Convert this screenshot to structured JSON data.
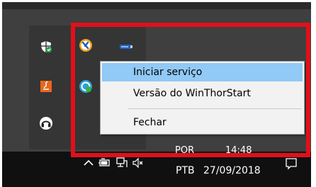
{
  "context_menu": {
    "items": [
      {
        "label": "Iniciar serviço",
        "highlighted": true
      },
      {
        "label": "Versão do WinThorStart",
        "highlighted": false
      },
      {
        "label": "Fechar",
        "highlighted": false
      }
    ]
  },
  "tray_overflow": {
    "icons": [
      "windows-defender-shield-icon",
      "winthor-app-icon",
      "usb-drive-icon",
      "java-icon",
      "refresh-sync-icon",
      "headset-app-icon"
    ]
  },
  "taskbar": {
    "language_line1": "POR",
    "language_line2": "PTB",
    "time": "14:48",
    "date": "27/09/2018",
    "icons": [
      "chevron-up-icon",
      "battery-icon",
      "network-icon",
      "volume-muted-icon",
      "action-center-icon"
    ]
  },
  "colors": {
    "highlight": "#91c9f7",
    "annotation_box": "#e0101a",
    "taskbar": "#101010",
    "flyout": "#353535"
  }
}
